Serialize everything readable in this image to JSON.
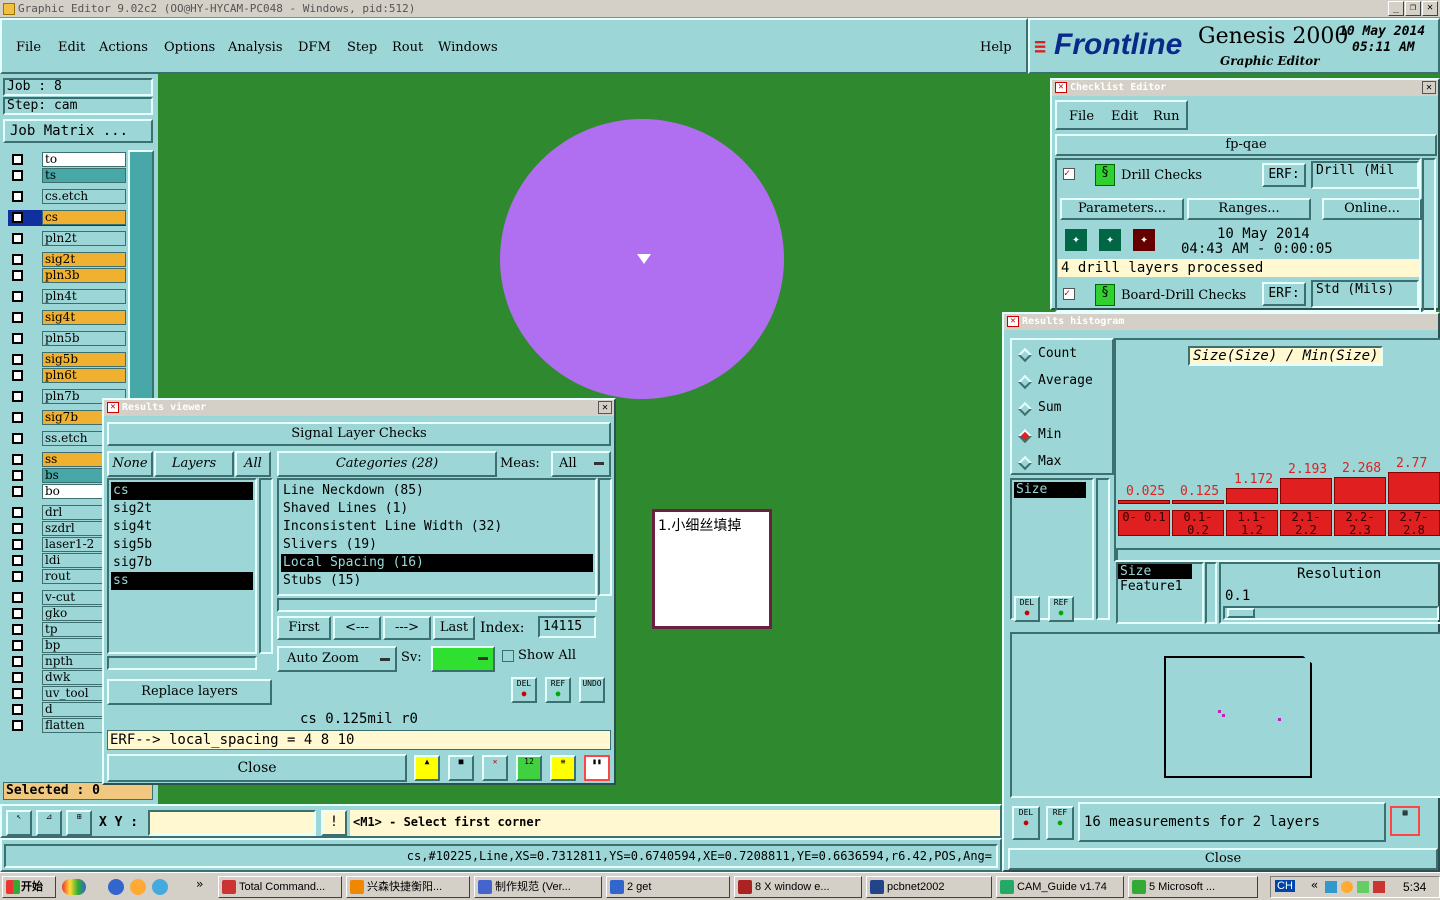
{
  "titlebar": {
    "title": "Graphic Editor 9.02c2  (OO@HY-HYCAM-PC048 - Windows, pid:512)"
  },
  "menu": {
    "items": [
      "File",
      "Edit",
      "Actions",
      "Options",
      "Analysis",
      "DFM",
      "Step",
      "Rout",
      "Windows"
    ],
    "help": "Help"
  },
  "brand": {
    "logo": "Frontline",
    "product": "Genesis 2000",
    "subtitle": "Graphic Editor",
    "date": "10 May 2014",
    "time": "05:11 AM"
  },
  "left": {
    "job": "Job  :  8",
    "step": "Step:  cam",
    "job_matrix": "Job Matrix ...",
    "layers": [
      {
        "name": "to",
        "color": "white"
      },
      {
        "name": "ts",
        "color": "teal2"
      },
      {
        "name": "cs.etch",
        "color": "teal"
      },
      {
        "name": "cs",
        "color": "orange"
      },
      {
        "name": "pln2t",
        "color": "teal"
      },
      {
        "name": "sig2t",
        "color": "orange"
      },
      {
        "name": "pln3b",
        "color": "orange"
      },
      {
        "name": "pln4t",
        "color": "teal"
      },
      {
        "name": "sig4t",
        "color": "orange"
      },
      {
        "name": "pln5b",
        "color": "teal"
      },
      {
        "name": "sig5b",
        "color": "orange"
      },
      {
        "name": "pln6t",
        "color": "orange"
      },
      {
        "name": "pln7b",
        "color": "teal"
      },
      {
        "name": "sig7b",
        "color": "orange"
      },
      {
        "name": "ss.etch",
        "color": "teal"
      },
      {
        "name": "ss",
        "color": "orange"
      },
      {
        "name": "bs",
        "color": "teal2"
      },
      {
        "name": "bo",
        "color": "white"
      },
      {
        "name": "drl",
        "color": "teal"
      },
      {
        "name": "szdrl",
        "color": "teal"
      },
      {
        "name": "laser1-2",
        "color": "teal"
      },
      {
        "name": "ldi",
        "color": "teal"
      },
      {
        "name": "rout",
        "color": "teal"
      },
      {
        "name": "v-cut",
        "color": "teal"
      },
      {
        "name": "gko",
        "color": "teal"
      },
      {
        "name": "tp",
        "color": "teal"
      },
      {
        "name": "bp",
        "color": "teal"
      },
      {
        "name": "npth",
        "color": "teal"
      },
      {
        "name": "dwk",
        "color": "teal"
      },
      {
        "name": "uv_tool",
        "color": "teal"
      },
      {
        "name": "d",
        "color": "teal"
      },
      {
        "name": "flatten",
        "color": "teal"
      }
    ],
    "selected": "Selected : 0"
  },
  "note": {
    "text": "1.小细丝填掉"
  },
  "results_viewer": {
    "title": "Results viewer",
    "header": "Signal Layer Checks",
    "none": "None",
    "layers": "Layers",
    "all": "All",
    "categories": "Categories  (28)",
    "meas_label": "Meas:",
    "meas_value": "All",
    "layer_list": [
      {
        "name": "cs",
        "sel": true
      },
      {
        "name": "sig2t",
        "sel": false
      },
      {
        "name": "sig4t",
        "sel": false
      },
      {
        "name": "sig5b",
        "sel": false
      },
      {
        "name": "sig7b",
        "sel": false
      },
      {
        "name": "ss",
        "sel": true
      }
    ],
    "category_list": [
      {
        "name": "Line Neckdown (85)",
        "sel": false
      },
      {
        "name": "Shaved Lines (1)",
        "sel": false
      },
      {
        "name": "Inconsistent Line Width (32)",
        "sel": false
      },
      {
        "name": "Slivers (19)",
        "sel": false
      },
      {
        "name": "Local Spacing (16)",
        "sel": true
      },
      {
        "name": "Stubs (15)",
        "sel": false
      }
    ],
    "first": "First",
    "prev": "<---",
    "next": "--->",
    "last": "Last",
    "index_label": "Index:",
    "index_value": "14115",
    "auto_zoom": "Auto Zoom",
    "sv": "Sv:",
    "show_all": "Show All",
    "replace_layers": "Replace layers",
    "status": "cs 0.125mil   r0",
    "erf": "ERF--> local_spacing = 4 8 10",
    "close": "Close",
    "del": "DEL",
    "ref": "REF",
    "undo": "UNDO"
  },
  "checklist": {
    "title": "Checklist Editor",
    "menu": [
      "File",
      "Edit",
      "Run"
    ],
    "name": "fp-qae",
    "item1": {
      "label": "Drill Checks",
      "erf": "ERF:",
      "erf_value": "Drill (Mil"
    },
    "parameters": "Parameters...",
    "ranges": "Ranges...",
    "online": "Online...",
    "run_date": "10 May 2014",
    "run_time": "04:43 AM - 0:00:05",
    "processed": "4 drill layers processed",
    "item2": {
      "label": "Board-Drill Checks",
      "erf": "ERF:",
      "erf_value": "Std (Mils)"
    }
  },
  "histogram": {
    "title": "Results histogram",
    "modes": [
      {
        "label": "Count",
        "on": false
      },
      {
        "label": "Average",
        "on": false
      },
      {
        "label": "Sum",
        "on": false
      },
      {
        "label": "Min",
        "on": true
      },
      {
        "label": "Max",
        "on": false
      }
    ],
    "size_item": "Size",
    "chart_title": "Size(Size) / Min(Size)",
    "resolution_label": "Resolution",
    "resolution_value": "0.1",
    "size2": "Size",
    "feature1": "Feature1",
    "measurements": "16 measurements for 2 layers",
    "close": "Close",
    "del": "DEL",
    "ref": "REF"
  },
  "chart_data": {
    "type": "bar",
    "categories": [
      "0-\n0.1",
      "0.1-\n0.2",
      "1.1-\n1.2",
      "2.1-\n2.2",
      "2.2-\n2.3",
      "2.7-\n2.8"
    ],
    "values": [
      0.025,
      0.125,
      1.172,
      2.193,
      2.268,
      2.771
    ],
    "value_labels": [
      "0.025",
      "0.125",
      "1.172",
      "2.193",
      "2.268",
      "2.77"
    ],
    "title": "Size(Size) / Min(Size)",
    "colors": {
      "bar": "#e02020"
    }
  },
  "cmdline": {
    "xy_label": "X Y :",
    "xy_value": "",
    "prompt": "<M1> - Select first corner"
  },
  "statusline": {
    "text": "cs,#10225,Line,XS=0.7312811,YS=0.6740594,XE=0.7208811,YE=0.6636594,r6.42,POS,Ang="
  },
  "taskbar": {
    "start": "开始",
    "tasks": [
      "Total Command...",
      "兴森快捷衡阳...",
      "制作规范  (Ver...",
      "2 get",
      "8 X window e...",
      "pcbnet2002",
      "CAM_Guide v1.74",
      "5 Microsoft ..."
    ],
    "lang": "CH",
    "clock": "5:34"
  },
  "colors": {
    "teal": "#9cd6d6",
    "canvas": "#2f8a2f",
    "pad": "#b06ef0",
    "orange": "#f0b030"
  }
}
